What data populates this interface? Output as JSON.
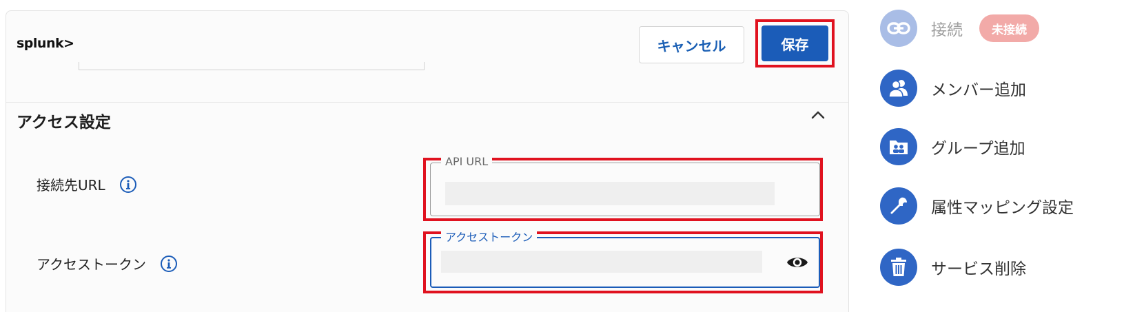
{
  "header": {
    "logo_text": "splunk>",
    "cancel_label": "キャンセル",
    "save_label": "保存"
  },
  "access_settings": {
    "title": "アクセス設定",
    "api_url": {
      "label": "接続先URL",
      "legend": "API URL"
    },
    "access_token": {
      "label": "アクセストークン",
      "legend": "アクセストークン"
    }
  },
  "sidebar": {
    "items": [
      {
        "label": "接続",
        "icon": "link-icon",
        "disabled": true,
        "badge": "未接続"
      },
      {
        "label": "メンバー追加",
        "icon": "users-icon"
      },
      {
        "label": "グループ追加",
        "icon": "group-folder-icon"
      },
      {
        "label": "属性マッピング設定",
        "icon": "wrench-icon"
      },
      {
        "label": "サービス削除",
        "icon": "trash-icon"
      }
    ]
  },
  "colors": {
    "primary": "#1b5cb8",
    "highlight": "#e0121f",
    "badge": "#f2aaa8",
    "icon_circle": "#2f66c5"
  }
}
